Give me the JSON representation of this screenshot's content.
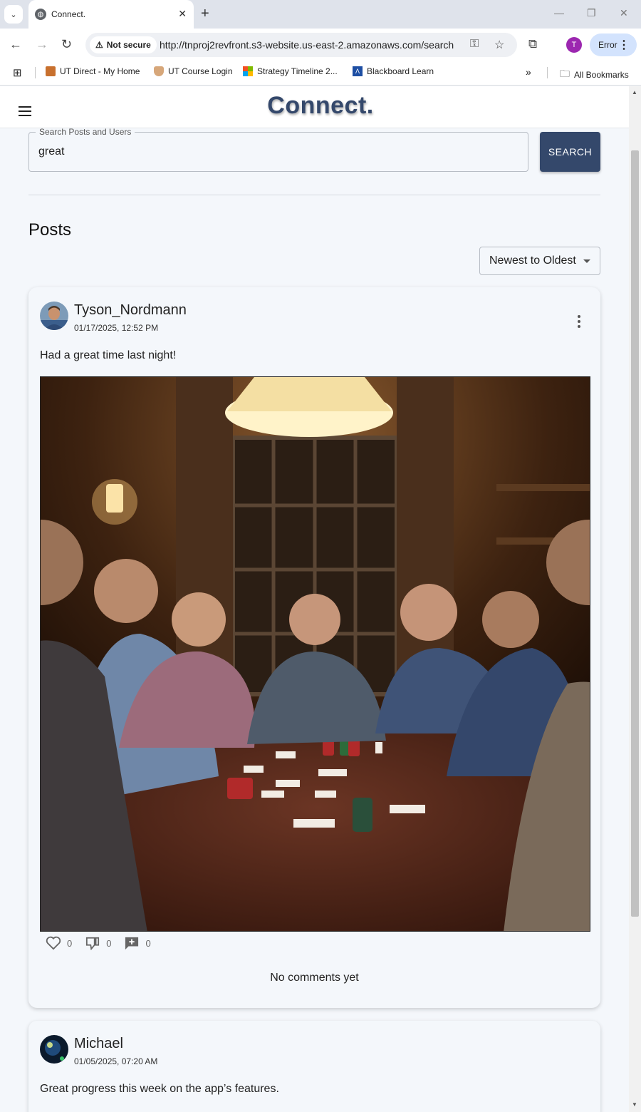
{
  "browser": {
    "tab_title": "Connect.",
    "url": "http://tnproj2revfront.s3-website.us-east-2.amazonaws.com/search",
    "security_label": "Not secure",
    "profile_initial": "T",
    "error_label": "Error",
    "bookmarks": [
      {
        "label": "UT Direct - My Home"
      },
      {
        "label": "UT Course Login"
      },
      {
        "label": "Strategy Timeline 2..."
      },
      {
        "label": "Blackboard Learn"
      }
    ],
    "all_bookmarks_label": "All Bookmarks"
  },
  "app": {
    "brand": "Connect.",
    "search": {
      "legend": "Search Posts and Users",
      "value": "great",
      "button_label": "SEARCH"
    },
    "section_title": "Posts",
    "sort": {
      "selected": "Newest to Oldest"
    }
  },
  "posts": [
    {
      "author": "Tyson_Nordmann",
      "timestamp": "01/17/2025, 12:52 PM",
      "text": "Had a great time last night!",
      "likes": "0",
      "dislikes": "0",
      "comments": "0",
      "no_comments_label": "No comments yet"
    },
    {
      "author": "Michael",
      "timestamp": "01/05/2025, 07:20 AM",
      "text": "Great progress this week on the app’s features."
    }
  ],
  "colors": {
    "brand": "#34486b",
    "page_bg": "#f4f7fb",
    "profile": "#9c27b0"
  }
}
